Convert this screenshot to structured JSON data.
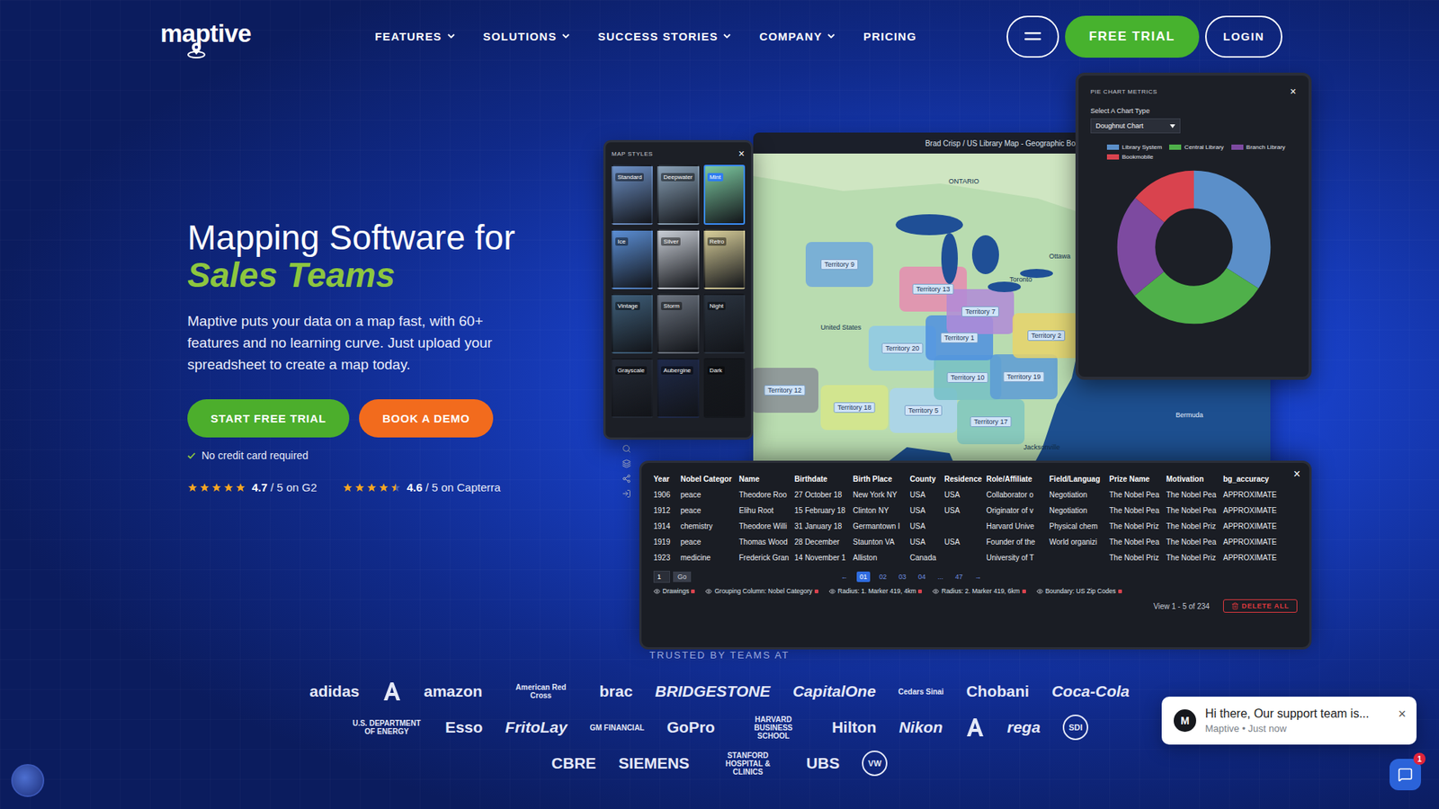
{
  "nav": {
    "logo": "maptive",
    "items": [
      {
        "label": "FEATURES",
        "dropdown": true
      },
      {
        "label": "SOLUTIONS",
        "dropdown": true
      },
      {
        "label": "SUCCESS STORIES",
        "dropdown": true
      },
      {
        "label": "COMPANY",
        "dropdown": true
      },
      {
        "label": "PRICING",
        "dropdown": false
      }
    ],
    "buttons": [
      {
        "label": "FREE TRIAL",
        "kind": "primary"
      },
      {
        "label": "LOGIN",
        "kind": "outline"
      }
    ]
  },
  "hero": {
    "title": "Mapping Software for",
    "highlight": "Sales Teams",
    "description": "Maptive puts your data on a map fast, with 60+ features and no learning curve. Just upload your spreadsheet to create a map today.",
    "buttons": [
      {
        "label": "START FREE TRIAL",
        "kind": "green"
      },
      {
        "label": "BOOK A DEMO",
        "kind": "orange"
      }
    ],
    "note": "No credit card required",
    "ratings": [
      {
        "stars": 5,
        "score": "4.7",
        "suffix": "/ 5 on G2"
      },
      {
        "stars": 4.5,
        "score": "4.6",
        "suffix": "/ 5 on Capterra"
      }
    ]
  },
  "mockup": {
    "map_styles": {
      "title": "MAP STYLES",
      "close": "×",
      "styles": [
        {
          "label": "Standard",
          "color": "#6f93c9",
          "selected": false
        },
        {
          "label": "Deepwater",
          "color": "#8aa2b8",
          "selected": false
        },
        {
          "label": "Mint",
          "color": "#7cc9a0",
          "selected": true
        },
        {
          "label": "Ice",
          "color": "#5b8fd6",
          "selected": false
        },
        {
          "label": "Silver",
          "color": "#c9ced6",
          "selected": false
        },
        {
          "label": "Retro",
          "color": "#d9cf9a",
          "selected": false
        },
        {
          "label": "Vintage",
          "color": "#3f5f7a",
          "selected": false
        },
        {
          "label": "Storm",
          "color": "#6c7480",
          "selected": false
        },
        {
          "label": "Night",
          "color": "#2b3440",
          "selected": false
        },
        {
          "label": "Grayscale",
          "color": "#242a36",
          "selected": false
        },
        {
          "label": "Aubergine",
          "color": "#1f2a4a",
          "selected": false
        },
        {
          "label": "Dark",
          "color": "#15181d",
          "selected": false
        }
      ]
    },
    "map": {
      "title": "Brad Crisp / US Library Map - Geographic Boundary",
      "territories": [
        {
          "label": "Territory 9",
          "color": "#6fa8dc"
        },
        {
          "label": "Territory 13",
          "color": "#e68bb0"
        },
        {
          "label": "Territory 20",
          "color": "#8ec9e8"
        },
        {
          "label": "Territory 12",
          "color": "#8a8f96"
        },
        {
          "label": "Territory 18",
          "color": "#d6e68a"
        },
        {
          "label": "Territory 5",
          "color": "#a9d4f0"
        },
        {
          "label": "Territory 10",
          "color": "#74c0c6"
        },
        {
          "label": "Territory 19",
          "color": "#5c9bd6"
        },
        {
          "label": "Territory 17",
          "color": "#7fc7c0"
        },
        {
          "label": "Territory 1",
          "color": "#4e8fe0"
        },
        {
          "label": "Territory 7",
          "color": "#b08ad8"
        },
        {
          "label": "Territory 2",
          "color": "#e8d36a"
        }
      ],
      "places": [
        {
          "label": "ONTARIO",
          "kind": "land"
        },
        {
          "label": "United States",
          "kind": "land"
        },
        {
          "label": "Ottawa",
          "kind": "land"
        },
        {
          "label": "Toronto",
          "kind": "land"
        },
        {
          "label": "Bermuda",
          "kind": "water"
        },
        {
          "label": "Jacksonville",
          "kind": "land"
        }
      ]
    },
    "pie": {
      "title": "PIE CHART METRICS",
      "close": "×",
      "select_label": "Select A Chart Type",
      "select_value": "Doughnut Chart",
      "series": [
        {
          "label": "Library System",
          "value": 34,
          "color": "#5b8fc9"
        },
        {
          "label": "Central Library",
          "value": 30,
          "color": "#4fb04a"
        },
        {
          "label": "Branch Library",
          "value": 22,
          "color": "#7d4aa0"
        },
        {
          "label": "Bookmobile",
          "value": 14,
          "color": "#d9434e"
        }
      ]
    },
    "table": {
      "close": "×",
      "columns": [
        "Year",
        "Nobel Categor",
        "Name",
        "Birthdate",
        "Birth Place",
        "County",
        "Residence",
        "Role/Affiliate",
        "Field/Languag",
        "Prize Name",
        "Motivation",
        "bg_accuracy"
      ],
      "rows": [
        [
          "1906",
          "peace",
          "Theodore Roo",
          "27 October 18",
          "New York NY",
          "USA",
          "USA",
          "Collaborator o",
          "Negotiation",
          "The Nobel Pea",
          "The Nobel Pea",
          "APPROXIMATE"
        ],
        [
          "1912",
          "peace",
          "Elihu Root",
          "15 February 18",
          "Clinton NY",
          "USA",
          "USA",
          "Originator of v",
          "Negotiation",
          "The Nobel Pea",
          "The Nobel Pea",
          "APPROXIMATE"
        ],
        [
          "1914",
          "chemistry",
          "Theodore Willi",
          "31 January 18",
          "Germantown I",
          "USA",
          "",
          "Harvard Unive",
          "Physical chem",
          "The Nobel Priz",
          "The Nobel Priz",
          "APPROXIMATE"
        ],
        [
          "1919",
          "peace",
          "Thomas Wood",
          "28 December",
          "Staunton VA",
          "USA",
          "USA",
          "Founder of the",
          "World organizi",
          "The Nobel Pea",
          "The Nobel Pea",
          "APPROXIMATE"
        ],
        [
          "1923",
          "medicine",
          "Frederick Gran",
          "14 November 1",
          "Alliston",
          "Canada",
          "",
          "University of T",
          "",
          "The Nobel Priz",
          "The Nobel Priz",
          "APPROXIMATE"
        ]
      ],
      "rows_per_page": {
        "value": "1",
        "button": "Go"
      },
      "pagination": {
        "prev": "←",
        "next": "→",
        "pages": [
          {
            "label": "01",
            "selected": true
          },
          {
            "label": "02",
            "selected": false
          },
          {
            "label": "03",
            "selected": false
          },
          {
            "label": "04",
            "selected": false
          },
          {
            "label": "...",
            "selected": false
          },
          {
            "label": "47",
            "selected": false
          }
        ]
      },
      "filters": [
        "Drawings",
        "Grouping Column: Nobel Category",
        "Radius: 1. Marker 419, 4km",
        "Radius: 2. Marker 419, 6km",
        "Boundary: US Zip Codes"
      ],
      "summary": "View 1 - 5 of 234",
      "delete": "DELETE ALL"
    }
  },
  "trusted": {
    "heading": "TRUSTED BY TEAMS AT",
    "rows": [
      [
        {
          "text": "adidas",
          "kind": "word"
        },
        {
          "text": "",
          "kind": "mark"
        },
        {
          "text": "amazon",
          "kind": "word"
        },
        {
          "text": "American Red Cross",
          "kind": "small"
        },
        {
          "text": "brac",
          "kind": "word"
        },
        {
          "text": "BRIDGESTONE",
          "kind": "italic"
        },
        {
          "text": "CapitalOne",
          "kind": "italic"
        },
        {
          "text": "Cedars Sinai",
          "kind": "small"
        },
        {
          "text": "Chobani",
          "kind": "word"
        },
        {
          "text": "Coca-Cola",
          "kind": "italic"
        }
      ],
      [
        {
          "text": "U.S. DEPARTMENT OF ENERGY",
          "kind": "small"
        },
        {
          "text": "Esso",
          "kind": "word"
        },
        {
          "text": "FritoLay",
          "kind": "italic"
        },
        {
          "text": "GM FINANCIAL",
          "kind": "small"
        },
        {
          "text": "GoPro",
          "kind": "word"
        },
        {
          "text": "HARVARD BUSINESS SCHOOL",
          "kind": "small"
        },
        {
          "text": "Hilton",
          "kind": "word"
        },
        {
          "text": "Nikon",
          "kind": "italic"
        },
        {
          "text": "",
          "kind": "mark"
        },
        {
          "text": "rega",
          "kind": "italic"
        },
        {
          "text": "SDI",
          "kind": "badge"
        }
      ],
      [
        {
          "text": "CBRE",
          "kind": "word"
        },
        {
          "text": "SIEMENS",
          "kind": "word"
        },
        {
          "text": "STANFORD HOSPITAL & CLINICS",
          "kind": "small"
        },
        {
          "text": "UBS",
          "kind": "word"
        },
        {
          "text": "VW",
          "kind": "badge"
        }
      ]
    ]
  },
  "chat": {
    "avatar": "M",
    "message": "Hi there, Our support team is...",
    "meta": "Maptive • Just now",
    "close": "×",
    "badge": "1"
  }
}
